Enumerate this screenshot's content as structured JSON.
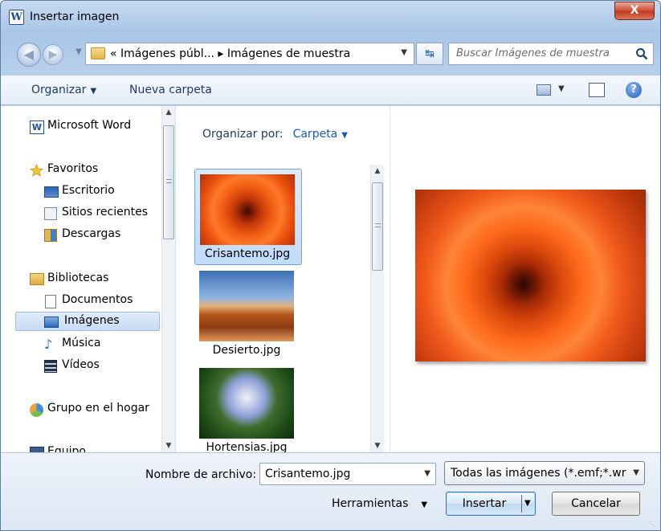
{
  "window": {
    "title": "Insertar imagen",
    "app_icon": "W",
    "close_label": "X"
  },
  "address": {
    "path": "« Imágenes públ... ▸ Imágenes de muestra",
    "search_placeholder": "Buscar Imágenes de muestra"
  },
  "toolbar": {
    "organize": "Organizar",
    "new_folder": "Nueva carpeta"
  },
  "nav": {
    "items": [
      {
        "label": "Microsoft Word",
        "icon": "word-icon"
      },
      {
        "label": "Favoritos",
        "icon": "star-icon"
      },
      {
        "label": "Escritorio",
        "icon": "desktop-icon"
      },
      {
        "label": "Sitios recientes",
        "icon": "recent-places-icon"
      },
      {
        "label": "Descargas",
        "icon": "downloads-icon"
      },
      {
        "label": "Bibliotecas",
        "icon": "libraries-icon"
      },
      {
        "label": "Documentos",
        "icon": "documents-icon"
      },
      {
        "label": "Imágenes",
        "icon": "pictures-icon",
        "selected": true
      },
      {
        "label": "Música",
        "icon": "music-icon"
      },
      {
        "label": "Vídeos",
        "icon": "videos-icon"
      },
      {
        "label": "Grupo en el hogar",
        "icon": "homegroup-icon"
      },
      {
        "label": "Equipo",
        "icon": "computer-icon"
      }
    ]
  },
  "files": {
    "arrange_label": "Organizar por:",
    "arrange_value": "Carpeta",
    "items": [
      {
        "name": "Crisantemo.jpg",
        "selected": true
      },
      {
        "name": "Desierto.jpg"
      },
      {
        "name": "Hortensias.jpg"
      }
    ]
  },
  "bottom": {
    "filename_label": "Nombre de archivo:",
    "filename_value": "Crisantemo.jpg",
    "filetype_value": "Todas las imágenes (*.emf;*.wr",
    "tools_label": "Herramientas",
    "insert_label": "Insertar",
    "cancel_label": "Cancelar"
  },
  "colors": {
    "accent": "#1b5ab8",
    "close": "#c23a1f",
    "selection": "#c1dbfb"
  }
}
